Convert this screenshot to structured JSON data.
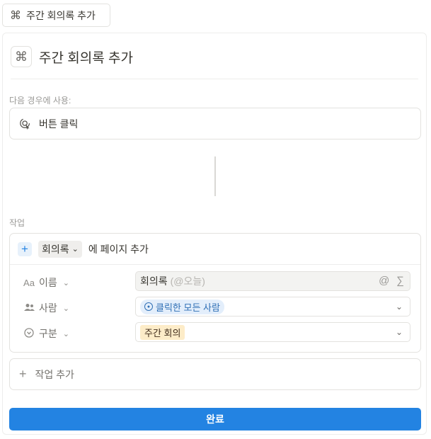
{
  "top_chip": {
    "icon": "command-icon",
    "label": "주간 회의록 추가"
  },
  "header": {
    "icon": "command-icon",
    "title": "주간 회의록 추가"
  },
  "trigger": {
    "section_label": "다음 경우에 사용:",
    "icon": "button-click-icon",
    "label": "버튼 클릭"
  },
  "actions": {
    "section_label": "작업",
    "add_page": {
      "plus": "+",
      "database": "회의록",
      "suffix": "에 페이지 추가"
    },
    "properties": [
      {
        "icon": "Aa",
        "label": "이름",
        "value": "회의록",
        "hint": "(@오늘)",
        "field_icons": [
          "@",
          "∑"
        ]
      },
      {
        "icon": "people-icon",
        "label": "사람",
        "value": "클릭한 모든 사람"
      },
      {
        "icon": "select-icon",
        "label": "구분",
        "value": "주간 회의"
      }
    ],
    "add_action": {
      "plus": "+",
      "label": "작업 추가"
    }
  },
  "done_button": "완료",
  "colors": {
    "accent": "#2383e2",
    "person_pill_bg": "#e3eefb",
    "tag_bg": "#fdecc8"
  }
}
